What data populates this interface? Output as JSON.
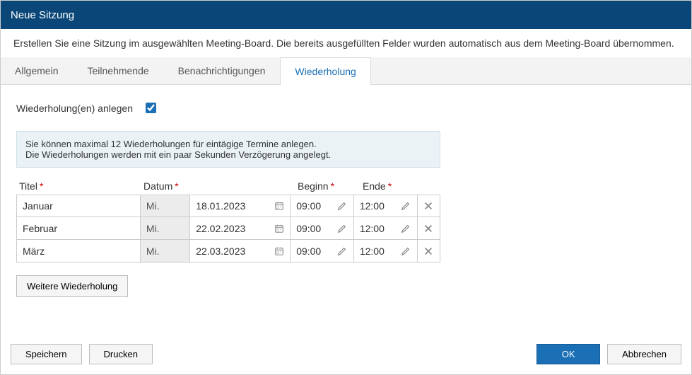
{
  "titlebar": {
    "title": "Neue Sitzung"
  },
  "description": "Erstellen Sie eine Sitzung im ausgewählten Meeting-Board. Die bereits ausgefüllten Felder wurden automatisch aus dem Meeting-Board übernommen.",
  "tabs": [
    {
      "label": "Allgemein"
    },
    {
      "label": "Teilnehmende"
    },
    {
      "label": "Benachrichtigungen"
    },
    {
      "label": "Wiederholung",
      "active": true
    }
  ],
  "checkbox": {
    "label": "Wiederholung(en) anlegen",
    "checked": true
  },
  "infobox": {
    "line1": "Sie können maximal 12 Wiederholungen für eintägige Termine anlegen.",
    "line2": "Die Wiederholungen werden mit ein paar Sekunden Verzögerung angelegt."
  },
  "columns": {
    "title": "Titel",
    "date": "Datum",
    "begin": "Beginn",
    "end": "Ende"
  },
  "rows": [
    {
      "title": "Januar",
      "day": "Mi.",
      "date": "18.01.2023",
      "begin": "09:00",
      "end": "12:00"
    },
    {
      "title": "Februar",
      "day": "Mi.",
      "date": "22.02.2023",
      "begin": "09:00",
      "end": "12:00"
    },
    {
      "title": "März",
      "day": "Mi.",
      "date": "22.03.2023",
      "begin": "09:00",
      "end": "12:00"
    }
  ],
  "buttons": {
    "add": "Weitere Wiederholung",
    "save": "Speichern",
    "print": "Drucken",
    "ok": "OK",
    "cancel": "Abbrechen"
  }
}
